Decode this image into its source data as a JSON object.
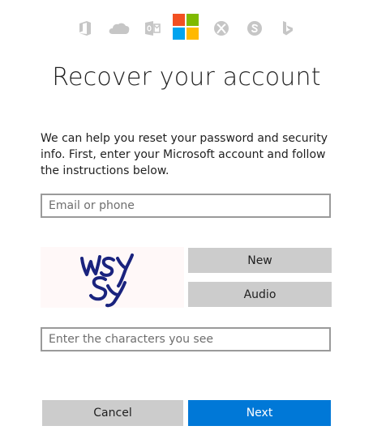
{
  "header": {
    "product_icons": [
      "office-icon",
      "onedrive-icon",
      "outlook-icon",
      "microsoft-logo",
      "xbox-icon",
      "skype-icon",
      "bing-icon"
    ],
    "title": "Recover your account"
  },
  "description": "We can help you reset your password and security info. First, enter your Microsoft account and follow the instructions below.",
  "form": {
    "email_placeholder": "Email or phone",
    "captcha_text": "WSYSY",
    "captcha_new_label": "New",
    "captcha_audio_label": "Audio",
    "captcha_input_placeholder": "Enter the characters you see"
  },
  "actions": {
    "cancel_label": "Cancel",
    "next_label": "Next"
  },
  "colors": {
    "primary": "#0078d7",
    "secondary_button": "#cccccc",
    "icon_gray": "#c6c6c6",
    "captcha_ink": "#1a237e"
  }
}
